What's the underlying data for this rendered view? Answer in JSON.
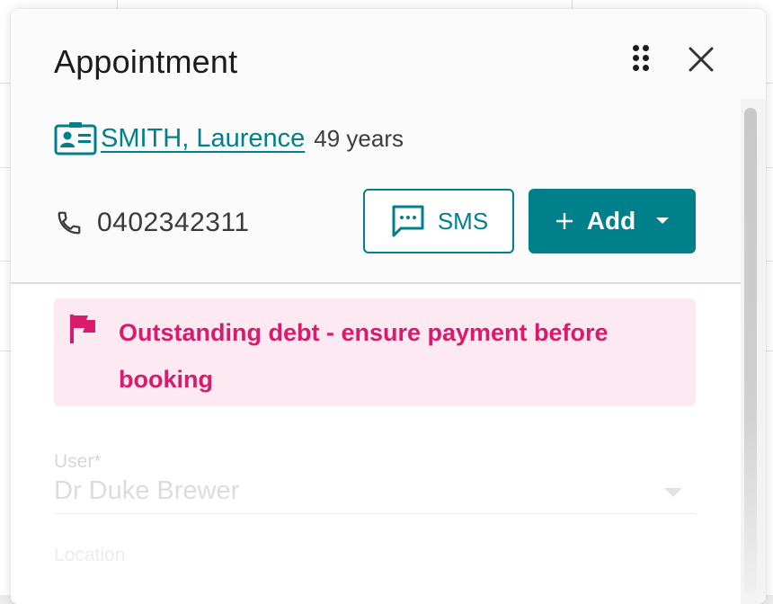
{
  "dialog": {
    "title": "Appointment",
    "icons": {
      "drag": "drag-handle-icon",
      "close": "close-icon"
    }
  },
  "patient": {
    "name": "SMITH, Laurence",
    "age": "49 years",
    "icon": "id-card-icon"
  },
  "contact": {
    "phone": "0402342311",
    "phone_icon": "phone-icon"
  },
  "actions": {
    "sms_label": "SMS",
    "sms_icon": "message-icon",
    "add_label": "Add",
    "add_icons": [
      "plus-icon",
      "caret-down-icon"
    ]
  },
  "alert": {
    "text": "Outstanding debt - ensure payment before booking",
    "icon": "flag-icon"
  },
  "form": {
    "user_label": "User*",
    "user_value": "Dr Duke Brewer",
    "location_label": "Location"
  },
  "colors": {
    "accent": "#00808a",
    "alert_text": "#d81b6a",
    "alert_background": "#fde9f1"
  }
}
